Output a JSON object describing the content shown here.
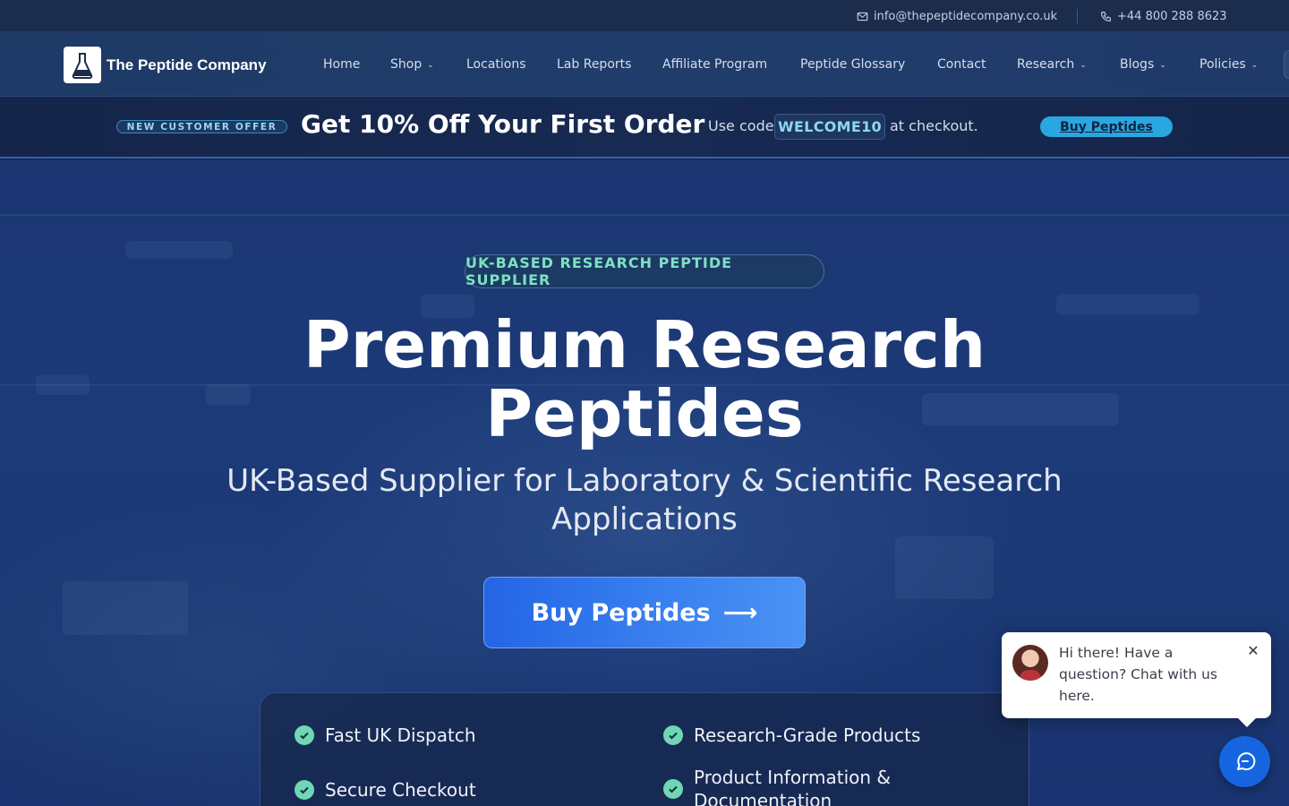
{
  "topbar": {
    "email": "info@thepeptidecompany.co.uk",
    "phone": "+44 800 288 8623"
  },
  "brand": {
    "name": "The Peptide Company",
    "logo_icon": "flask-icon"
  },
  "nav": {
    "items": [
      {
        "label": "Home",
        "dropdown": false
      },
      {
        "label": "Shop",
        "dropdown": true
      },
      {
        "label": "Locations",
        "dropdown": false
      },
      {
        "label": "Lab Reports",
        "dropdown": false
      },
      {
        "label": "Affiliate Program",
        "dropdown": false
      },
      {
        "label": "Peptide Glossary",
        "dropdown": false
      },
      {
        "label": "Contact",
        "dropdown": false
      },
      {
        "label": "Research",
        "dropdown": true
      },
      {
        "label": "Blogs",
        "dropdown": true
      },
      {
        "label": "Policies",
        "dropdown": true
      }
    ]
  },
  "promo": {
    "badge": "NEW CUSTOMER OFFER",
    "headline": "Get 10% Off Your First Order",
    "use_code": "Use code",
    "code": "WELCOME10",
    "at_checkout": "at checkout.",
    "button": "Buy Peptides"
  },
  "hero": {
    "badge": "UK-BASED RESEARCH PEPTIDE SUPPLIER",
    "title_line1": "Premium Research",
    "title_line2": "Peptides",
    "subtitle": "UK-Based Supplier for Laboratory & Scientific Research Applications",
    "cta": "Buy Peptides",
    "cta_arrow": "⟶"
  },
  "features": [
    "Fast UK Dispatch",
    "Research-Grade Products",
    "Secure Checkout",
    "Product Information & Documentation"
  ],
  "chat": {
    "message": "Hi there! Have a question? Chat with us here.",
    "close": "✕"
  },
  "colors": {
    "accent": "#2aa7e0",
    "cta": "#2565e6",
    "check": "#6fd7b4",
    "badge_text": "#7ee0c5"
  }
}
